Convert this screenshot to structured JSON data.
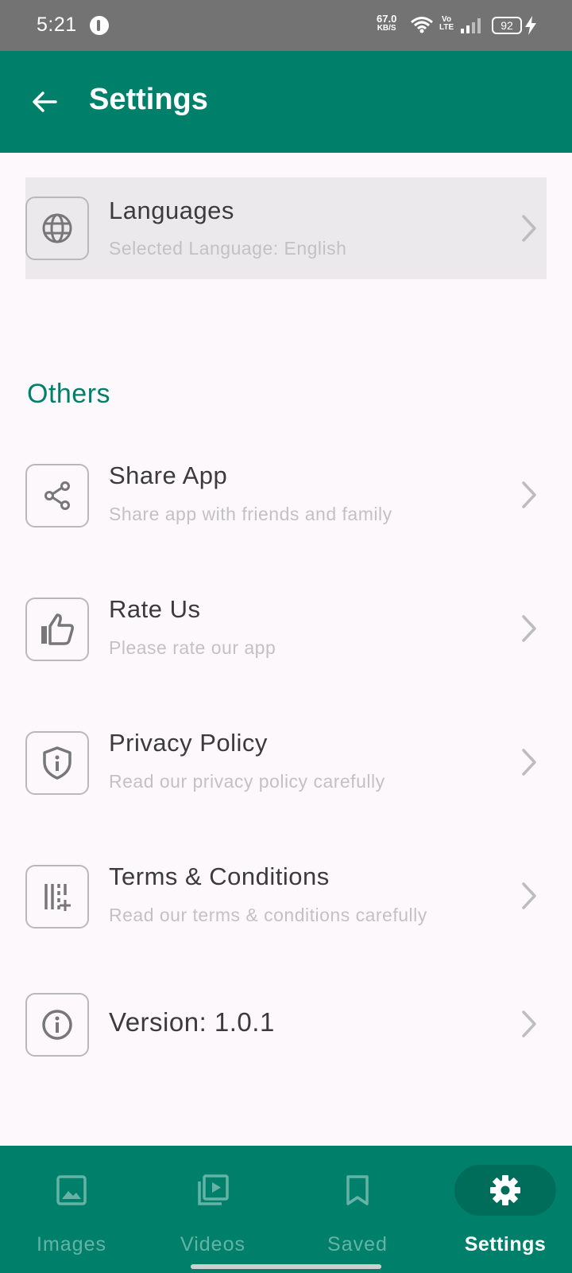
{
  "status_bar": {
    "time": "5:21",
    "speed_value": "67.0",
    "speed_unit": "KB/S",
    "volte_top": "Vo",
    "volte_bottom": "LTE",
    "battery": "92"
  },
  "app_bar": {
    "title": "Settings"
  },
  "language_row": {
    "title": "Languages",
    "subtitle": "Selected Language: English",
    "icon": "globe-icon"
  },
  "others": {
    "header": "Others",
    "items": [
      {
        "title": "Share App",
        "subtitle": "Share app with friends and family",
        "icon": "share-icon"
      },
      {
        "title": "Rate Us",
        "subtitle": "Please rate our app",
        "icon": "thumbs-up-icon"
      },
      {
        "title": "Privacy Policy",
        "subtitle": "Read our privacy policy carefully",
        "icon": "shield-icon"
      },
      {
        "title": "Terms & Conditions",
        "subtitle": "Read our terms & conditions carefully",
        "icon": "terms-icon"
      },
      {
        "title": "Version: 1.0.1",
        "icon": "info-icon"
      }
    ]
  },
  "bottom_nav": {
    "items": [
      {
        "label": "Images",
        "icon": "image-icon"
      },
      {
        "label": "Videos",
        "icon": "video-library-icon"
      },
      {
        "label": "Saved",
        "icon": "bookmark-icon"
      },
      {
        "label": "Settings",
        "icon": "gear-icon",
        "active": true
      }
    ]
  },
  "colors": {
    "primary": "#00806a",
    "status_bar": "#737373",
    "background": "#fdf8fc",
    "highlight": "#ece9ec"
  }
}
